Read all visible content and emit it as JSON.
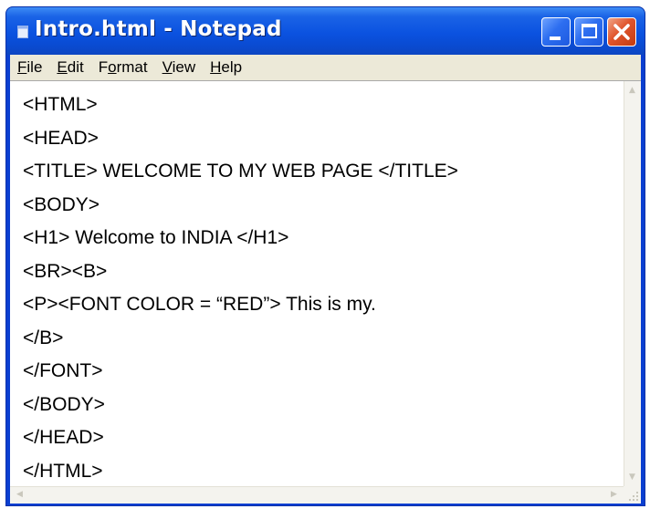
{
  "window": {
    "title": "Intro.html - Notepad",
    "controls": {
      "minimize_icon": "minimize-icon",
      "maximize_icon": "maximize-icon",
      "close_icon": "close-icon"
    }
  },
  "menu": {
    "items": [
      {
        "accel": "F",
        "rest": "ile"
      },
      {
        "accel": "E",
        "rest": "dit"
      },
      {
        "accel": "o",
        "pre": "F",
        "rest": "rmat"
      },
      {
        "accel": "V",
        "rest": "iew"
      },
      {
        "accel": "H",
        "rest": "elp"
      }
    ]
  },
  "editor": {
    "lines": [
      "<HTML>",
      "<HEAD>",
      "<TITLE> WELCOME TO MY WEB PAGE </TITLE>",
      "<BODY>",
      "<H1> Welcome to INDIA </H1>",
      "<BR><B>",
      "<P><FONT COLOR = “RED”> This is my.",
      "</B>",
      "</FONT>",
      "</BODY>",
      "</HEAD>",
      "</HTML>"
    ]
  },
  "colors": {
    "titlebar": "#0b52e0",
    "close_button": "#e0552d",
    "menubar": "#ece9d8",
    "editor_background": "#ffffff"
  }
}
